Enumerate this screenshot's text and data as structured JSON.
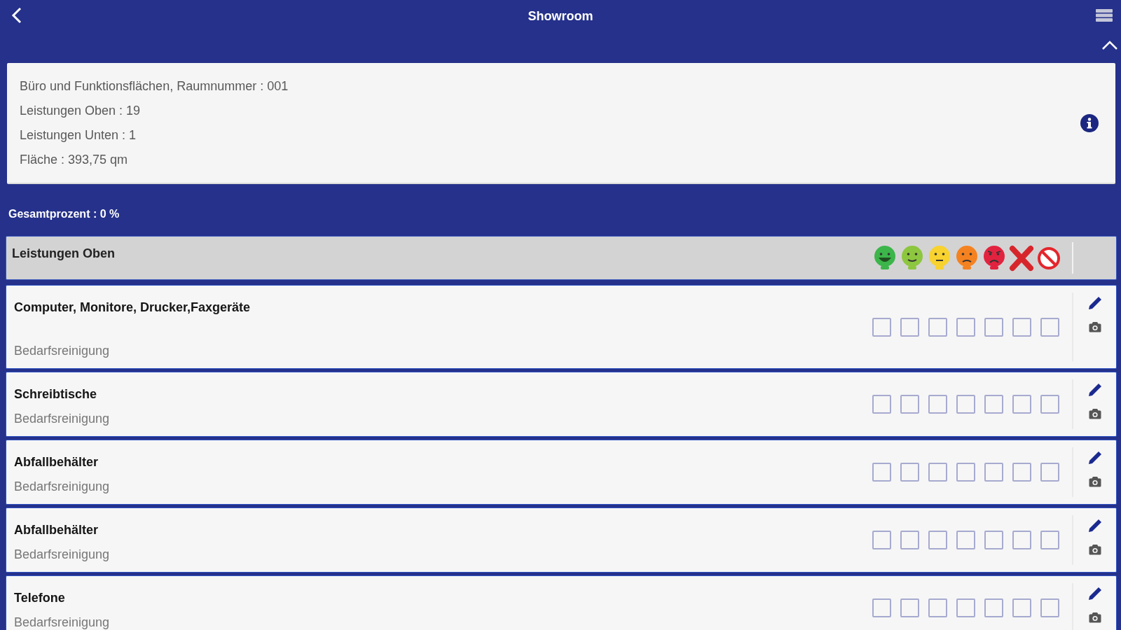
{
  "header": {
    "title": "Showroom"
  },
  "info": {
    "lines": [
      "Büro und Funktionsflächen, Raumnummer : 001",
      "Leistungen Oben : 19",
      "Leistungen Unten : 1",
      "Fläche : 393,75 qm"
    ]
  },
  "total": "Gesamtprozent : 0 %",
  "section": {
    "title": "Leistungen Oben",
    "ratings": [
      {
        "kind": "grin",
        "color": "#3cb54a"
      },
      {
        "kind": "smile",
        "color": "#8dc63f"
      },
      {
        "kind": "neutral",
        "color": "#f8d22f"
      },
      {
        "kind": "frown",
        "color": "#f58220"
      },
      {
        "kind": "angry",
        "color": "#e2233f"
      },
      {
        "kind": "cross",
        "color": "#d7262b"
      },
      {
        "kind": "forbidden",
        "color": "#e3262c"
      }
    ]
  },
  "items": [
    {
      "title": "Computer, Monitore, Drucker,Faxgeräte",
      "subtitle": "Bedarfsreinigung",
      "checks": [
        {
          "checked": false
        },
        {
          "checked": false
        },
        {
          "checked": false
        },
        {
          "checked": false
        },
        {
          "checked": false
        },
        {
          "checked": false
        },
        {
          "checked": false
        }
      ]
    },
    {
      "title": "Schreibtische",
      "subtitle": "Bedarfsreinigung",
      "checks": [
        {
          "checked": false
        },
        {
          "checked": false
        },
        {
          "checked": false
        },
        {
          "checked": false
        },
        {
          "checked": false
        },
        {
          "checked": false
        },
        {
          "checked": false
        }
      ]
    },
    {
      "title": "Abfallbehälter",
      "subtitle": "Bedarfsreinigung",
      "checks": [
        {
          "checked": false
        },
        {
          "checked": false
        },
        {
          "checked": false
        },
        {
          "checked": false
        },
        {
          "checked": false
        },
        {
          "checked": false
        },
        {
          "checked": false
        }
      ]
    },
    {
      "title": "Abfallbehälter",
      "subtitle": "Bedarfsreinigung",
      "checks": [
        {
          "checked": false
        },
        {
          "checked": false
        },
        {
          "checked": false
        },
        {
          "checked": false
        },
        {
          "checked": false
        },
        {
          "checked": false
        },
        {
          "checked": false
        }
      ]
    },
    {
      "title": "Telefone",
      "subtitle": "Bedarfsreinigung",
      "checks": [
        {
          "checked": false
        },
        {
          "checked": false
        },
        {
          "checked": false
        },
        {
          "checked": false
        },
        {
          "checked": false
        },
        {
          "checked": false
        },
        {
          "checked": false
        }
      ]
    }
  ]
}
